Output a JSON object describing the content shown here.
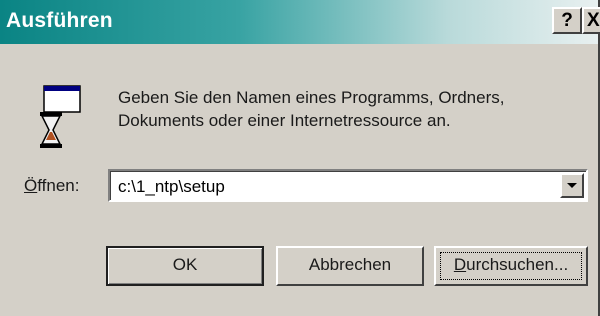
{
  "window": {
    "title": "Ausführen",
    "help_button": "?",
    "close_button": "X"
  },
  "message": "Geben Sie den Namen eines Programms, Ordners, Dokuments oder einer Internetressource an.",
  "open_field": {
    "label_prefix": "",
    "label_accel": "Ö",
    "label_rest": "ffnen:",
    "value": "c:\\1_ntp\\setup"
  },
  "buttons": {
    "ok": "OK",
    "cancel": "Abbrechen",
    "browse_accel": "D",
    "browse_rest": "urchsuchen..."
  },
  "icons": {
    "run": "run-program-icon",
    "dropdown": "chevron-down-icon"
  },
  "colors": {
    "titlebar_start": "#0a8484",
    "titlebar_end": "#e8f0f0",
    "face": "#d4d0c8"
  }
}
